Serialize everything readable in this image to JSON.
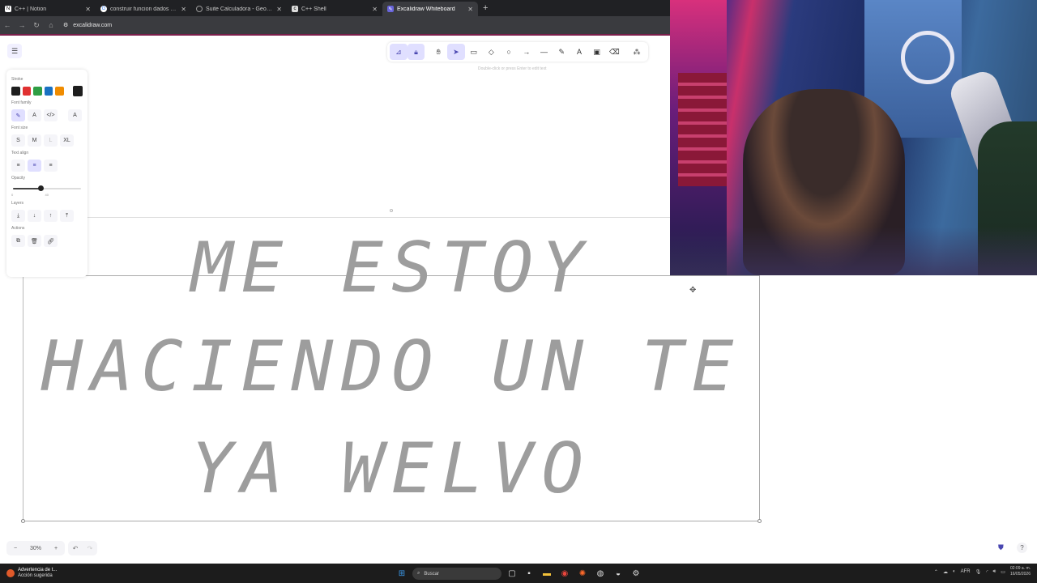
{
  "browser": {
    "tabs": [
      {
        "title": "C++ | Notion",
        "icon": "notion-icon",
        "color": "#ffffff"
      },
      {
        "title": "construir funcion dados dos pu",
        "icon": "google-icon",
        "color": "#4285f4"
      },
      {
        "title": "Suite Calculadora - GeoGebra",
        "icon": "geogebra-icon",
        "color": "#999999"
      },
      {
        "title": "C++ Shell",
        "icon": "cpp-icon",
        "color": "#ffffff"
      },
      {
        "title": "Excalidraw Whiteboard",
        "icon": "excalidraw-icon",
        "color": "#6965db"
      }
    ],
    "active_tab": 4,
    "url": "excalidraw.com"
  },
  "toolbar": {
    "tools": [
      "lock",
      "hand",
      "selection",
      "rectangle",
      "diamond",
      "ellipse",
      "arrow",
      "line",
      "draw",
      "text",
      "image",
      "eraser",
      "more"
    ],
    "hint": "Double-click or press Enter to edit text"
  },
  "props": {
    "stroke_label": "Stroke",
    "stroke_colors": [
      "#1e1e1e",
      "#e03131",
      "#2f9e44",
      "#1971c2",
      "#f08c00"
    ],
    "stroke_current": "#1e1e1e",
    "font_family_label": "Font family",
    "font_size_label": "Font size",
    "font_sizes": [
      "S",
      "M",
      "L",
      "XL"
    ],
    "text_align_label": "Text align",
    "opacity_label": "Opacity",
    "opacity_min": "0",
    "opacity_value": "40",
    "opacity_fraction": 0.4,
    "layers_label": "Layers",
    "actions_label": "Actions"
  },
  "canvas": {
    "lines": [
      "ME ESTOY",
      "HACIENDO UN TE",
      "YA WELVO"
    ]
  },
  "footer": {
    "zoom": "30%",
    "zoom_out": "−",
    "zoom_in": "+"
  },
  "taskbar": {
    "notif_title": "Advertencia de t...",
    "notif_sub": "Acción sugerida",
    "search": "Buscar",
    "lang": "AFR",
    "time": "02:09 a. m.",
    "date": "16/05/2026"
  }
}
